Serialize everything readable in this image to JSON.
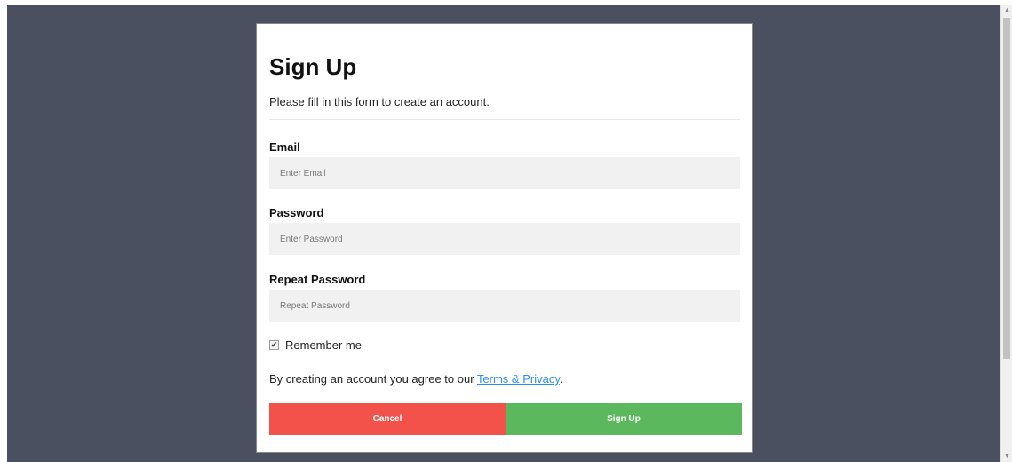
{
  "form": {
    "title": "Sign Up",
    "subtitle": "Please fill in this form to create an account.",
    "email_label": "Email",
    "email_placeholder": "Enter Email",
    "email_value": "",
    "password_label": "Password",
    "password_placeholder": "Enter Password",
    "password_value": "",
    "repeat_label": "Repeat Password",
    "repeat_placeholder": "Repeat Password",
    "repeat_value": "",
    "remember_label": "Remember me",
    "remember_checked": true,
    "terms_prefix": "By creating an account you agree to our ",
    "terms_link": "Terms & Privacy",
    "terms_suffix": ".",
    "cancel_label": "Cancel",
    "signup_label": "Sign Up"
  },
  "colors": {
    "backdrop": "#4b5060",
    "cancel": "#f2524a",
    "signup": "#5cb85c",
    "link": "#2b8ff0",
    "input_bg": "#f1f1f1"
  },
  "icons": {
    "checkbox": "checkmark-icon",
    "scroll_up": "triangle-up-icon",
    "scroll_down": "triangle-down-icon"
  }
}
